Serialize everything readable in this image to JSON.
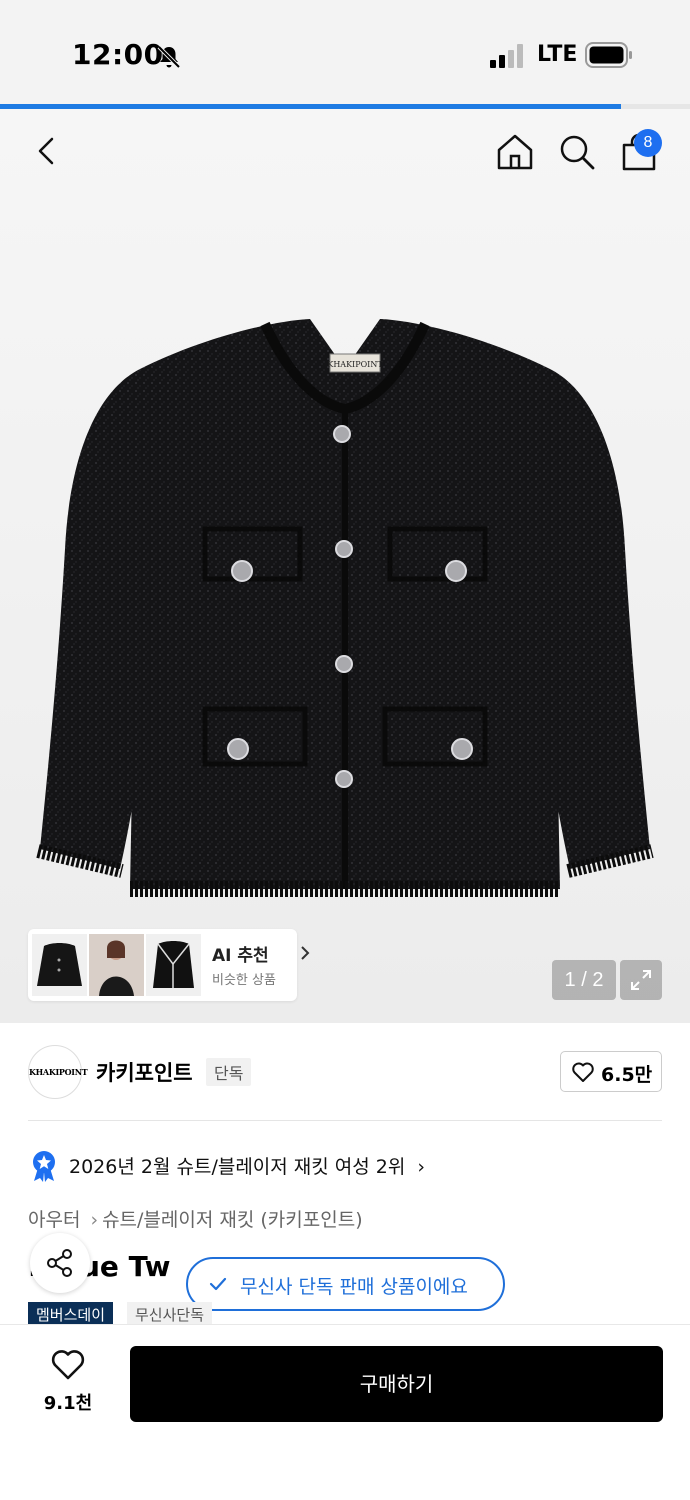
{
  "status_bar": {
    "time": "12:00",
    "network": "LTE"
  },
  "loading_progress": 0.9,
  "header": {
    "cart_count": "8"
  },
  "gallery": {
    "jacket_label": "KHAKIPOINT",
    "ai_title": "AI 추천",
    "ai_subtitle": "비슷한 상품",
    "page_indicator": "1 / 2"
  },
  "brand": {
    "logo_text": "KHAKIPOINT",
    "name": "카키포인트",
    "tag": "단독",
    "like_count": "6.5만"
  },
  "ranking": {
    "text": "2026년 2월 슈트/블레이저 재킷 여성 2위"
  },
  "breadcrumb": {
    "level1": "아우터",
    "level2": "슈트/블레이저 재킷 (카키포인트)"
  },
  "product": {
    "title_partial": "...que Tw"
  },
  "toast": {
    "text": "무신사 단독 판매 상품이에요"
  },
  "badges": {
    "member": "멤버스데이",
    "exclusive": "무신사단독"
  },
  "bottom_bar": {
    "wish_count": "9.1천",
    "buy_label": "구매하기"
  },
  "colors": {
    "accent": "#1e6ff0",
    "toast": "#1f6fd9",
    "member_badge": "#0b2f57",
    "buy_button": "#000000"
  }
}
